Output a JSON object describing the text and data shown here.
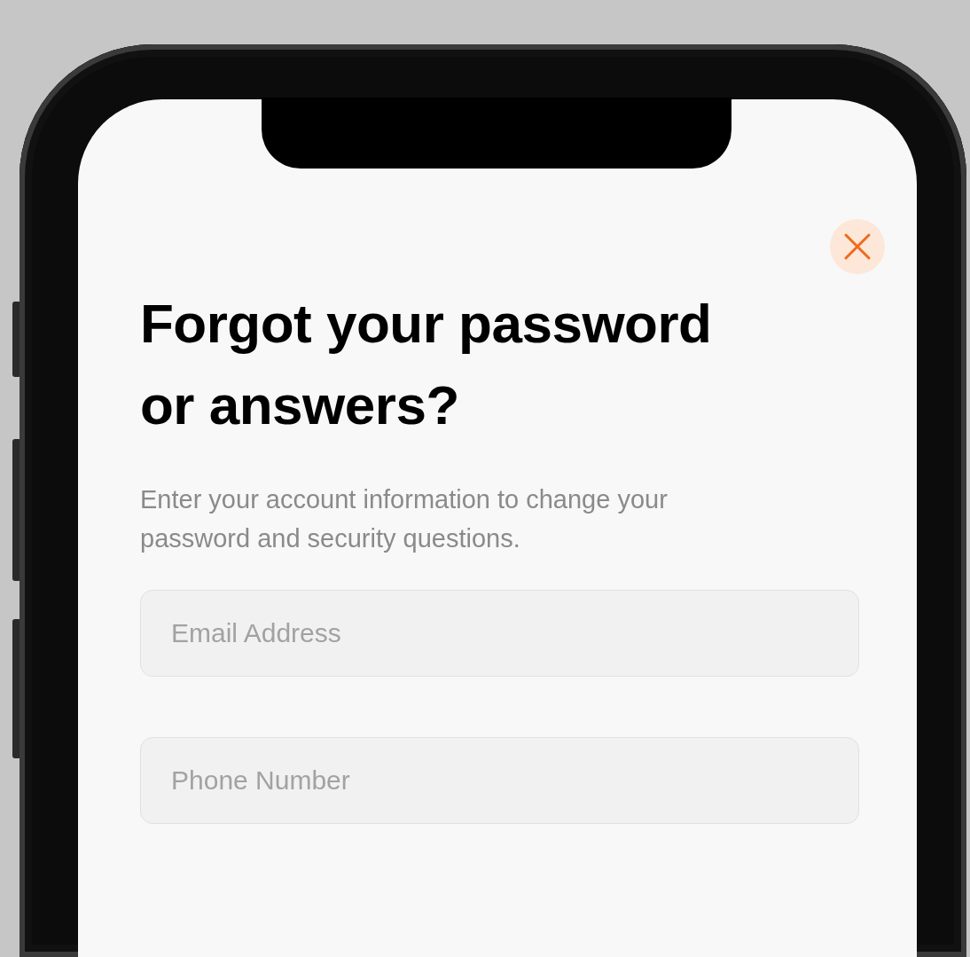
{
  "title": "Forgot your password or answers?",
  "subtitle": "Enter your account information to change your password and security questions.",
  "fields": [
    {
      "placeholder": "Email Address"
    },
    {
      "placeholder": "Phone Number"
    }
  ]
}
